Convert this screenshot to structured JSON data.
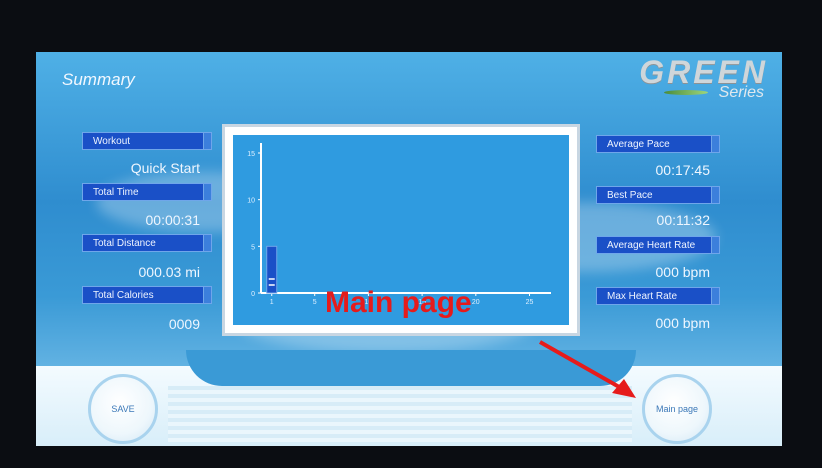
{
  "header": {
    "title": "Summary",
    "brand": "GREEN",
    "brand_sub": "Series"
  },
  "left_stats": [
    {
      "label": "Workout",
      "value": "Quick Start"
    },
    {
      "label": "Total Time",
      "value": "00:00:31"
    },
    {
      "label": "Total Distance",
      "value": "000.03 mi"
    },
    {
      "label": "Total Calories",
      "value": "0009"
    }
  ],
  "right_stats": [
    {
      "label": "Average Pace",
      "value": "00:17:45"
    },
    {
      "label": "Best Pace",
      "value": "00:11:32"
    },
    {
      "label": "Average Heart Rate",
      "value": "000 bpm"
    },
    {
      "label": "Max Heart Rate",
      "value": "000 bpm"
    }
  ],
  "chart_data": {
    "type": "bar",
    "x_ticks": [
      "1",
      "5",
      "10",
      "15",
      "20",
      "25"
    ],
    "y_ticks": [
      "0",
      "5",
      "10",
      "15"
    ],
    "ylim": [
      0,
      15
    ],
    "xlim": [
      0,
      27
    ],
    "values": [
      {
        "x": 1,
        "y": 5
      }
    ]
  },
  "buttons": {
    "save": "SAVE",
    "main_page": "Main page"
  },
  "annotation": {
    "text": "Main page",
    "color": "#e61b1b"
  },
  "colors": {
    "label_bg": "#1a50c7",
    "screen_bg": "#2f8dcf",
    "chart_bar": "#1a50c7"
  }
}
